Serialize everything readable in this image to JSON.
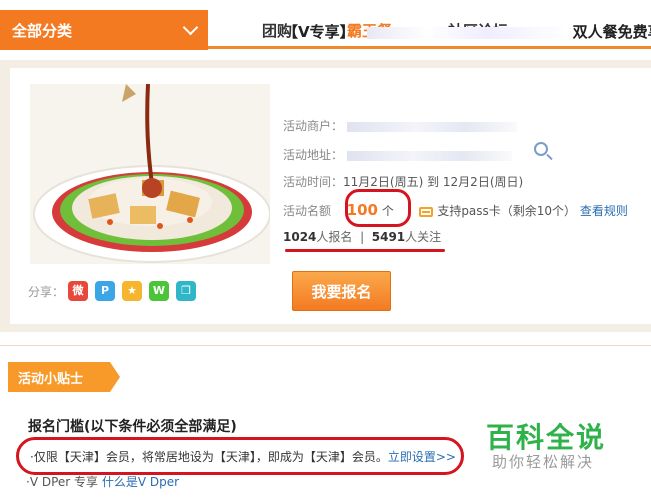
{
  "nav": {
    "all_categories": "全部分类",
    "tabs": [
      {
        "label": "团购",
        "active": false
      },
      {
        "label": "霸王餐",
        "active": true
      },
      {
        "label": "社区论坛",
        "active": false
      }
    ]
  },
  "deal": {
    "title_prefix": "【V专享】",
    "title_suffix": "双人餐免费享",
    "merchant_label": "活动商户：",
    "address_label": "活动地址：",
    "time_label": "活动时间：",
    "time_value": "11月2日(周五) 到 12月2日(周日)",
    "quota_label": "活动名额",
    "quota_value": "100",
    "quota_unit": "个",
    "pass_text": "支持pass卡（剩余10个）",
    "rules_link": "查看规则",
    "signup_count": "1024",
    "signup_label": "人报名",
    "separator": "|",
    "follow_count": "5491",
    "follow_label": "人关注",
    "share_label": "分享：",
    "signup_button": "我要报名"
  },
  "tips": {
    "flag": "活动小贴士",
    "req_title": "报名门槛(以下条件必须全部满足)",
    "req_text": "·仅限【天津】会员，将常居地设为【天津】，即成为【天津】会员。",
    "req_link": "立即设置>>",
    "vdp_text": "·V DPer 专享",
    "vdp_link": "什么是V Dper"
  },
  "watermark": {
    "line1": "百科全说",
    "line2": "助你轻松解决"
  },
  "colors": {
    "accent": "#f47a22",
    "highlight_red": "#d5141f",
    "link": "#2a6db3",
    "watermark_green": "#2fb24a"
  },
  "icons": [
    "chevron-down-icon",
    "search-icon",
    "pass-card-icon",
    "weibo-icon",
    "pinterest-icon",
    "star-icon",
    "wechat-icon",
    "copy-icon"
  ]
}
